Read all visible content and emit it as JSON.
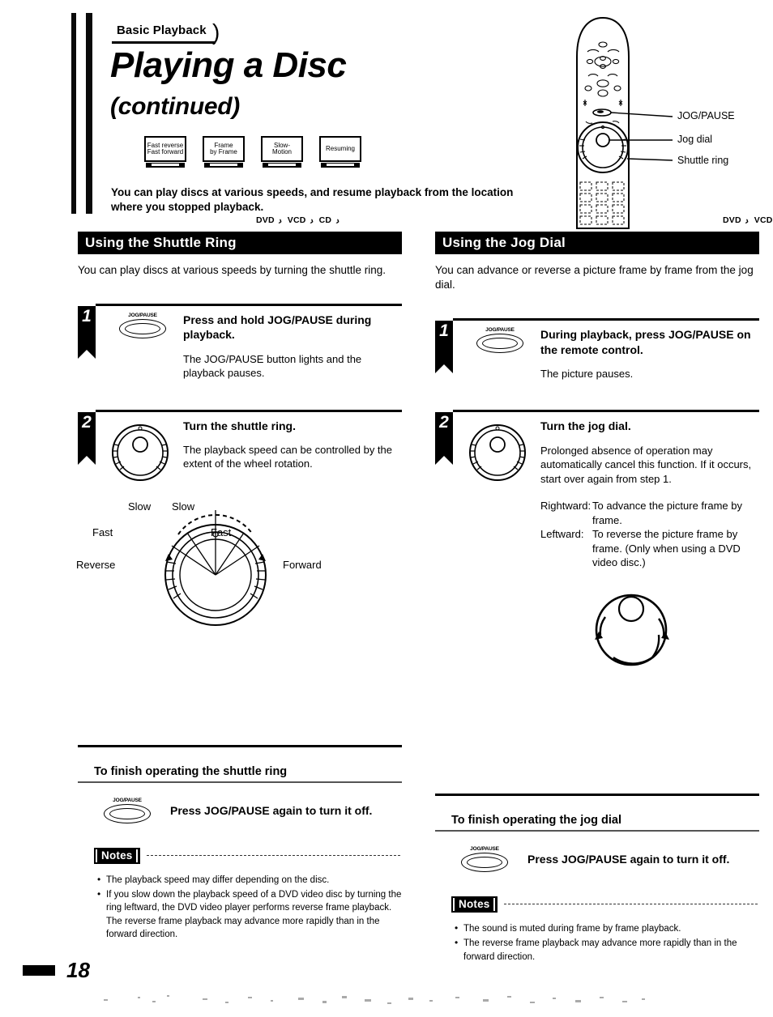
{
  "document": {
    "page_number": "18",
    "chapter_tab": "Basic Playback",
    "title": "Playing a Disc",
    "subtitle": "(continued)",
    "intro": "You can play discs at various speeds, and resume playback from the location where you stopped playback."
  },
  "feature_icons": [
    {
      "line1": "Fast reverse",
      "line2": "Fast forward"
    },
    {
      "line1": "Frame",
      "line2": "by Frame"
    },
    {
      "line1": "Slow-",
      "line2": "Motion"
    },
    {
      "line1": "Resuming",
      "line2": ""
    }
  ],
  "remote": {
    "callouts": [
      {
        "label": "JOG/PAUSE"
      },
      {
        "label": "Jog dial"
      },
      {
        "label": "Shuttle ring"
      }
    ],
    "badges": [
      "DVD",
      "VCD"
    ]
  },
  "left_section": {
    "badges": [
      "DVD",
      "VCD",
      "CD"
    ],
    "banner": "Using the Shuttle Ring",
    "intro": "You can play discs at various speeds by turning the shuttle ring.",
    "steps": [
      {
        "number": "1",
        "button_label": "JOG/PAUSE",
        "heading": "Press and hold JOG/PAUSE during playback.",
        "description": "The JOG/PAUSE button lights and the playback pauses."
      },
      {
        "number": "2",
        "heading": "Turn the shuttle ring.",
        "description": "The playback speed can be controlled by the extent of the wheel rotation."
      }
    ],
    "dial_diagram": {
      "slow_left": "Slow",
      "slow_right": "Slow",
      "fast_left": "Fast",
      "fast_right": "Fast",
      "reverse": "Reverse",
      "forward": "Forward"
    },
    "finish": {
      "title": "To finish operating the shuttle ring",
      "button_label": "JOG/PAUSE",
      "text": "Press JOG/PAUSE again to turn it off."
    },
    "notes": {
      "label": "Notes",
      "items": [
        "The playback speed may differ depending on the disc.",
        "If you slow down the playback speed of a DVD video disc by turning the ring leftward, the DVD video player performs reverse frame playback. The reverse frame playback may advance more rapidly than in the forward direction."
      ]
    }
  },
  "right_section": {
    "badges": [
      "DVD",
      "VCD"
    ],
    "banner": "Using the Jog Dial",
    "intro": "You can advance or reverse a picture frame by frame from the jog dial.",
    "steps": [
      {
        "number": "1",
        "button_label": "JOG/PAUSE",
        "heading": "During playback, press JOG/PAUSE on the remote control.",
        "description": "The picture pauses."
      },
      {
        "number": "2",
        "heading": "Turn the jog dial.",
        "description": "Prolonged absence of operation may automatically cancel this function. If it occurs, start over again from step 1.",
        "directions": [
          {
            "key": "Rightward:",
            "value": "To advance the picture frame by frame."
          },
          {
            "key": "Leftward:",
            "value": "To reverse the picture frame by frame. (Only when using a DVD video disc.)"
          }
        ]
      }
    ],
    "finish": {
      "title": "To finish operating the jog dial",
      "button_label": "JOG/PAUSE",
      "text": "Press JOG/PAUSE again to turn it off."
    },
    "notes": {
      "label": "Notes",
      "items": [
        "The sound is muted during frame by frame playback.",
        "The reverse frame playback may advance more rapidly than in the forward direction."
      ]
    }
  },
  "colors": {
    "ink": "#000000",
    "paper": "#ffffff"
  }
}
